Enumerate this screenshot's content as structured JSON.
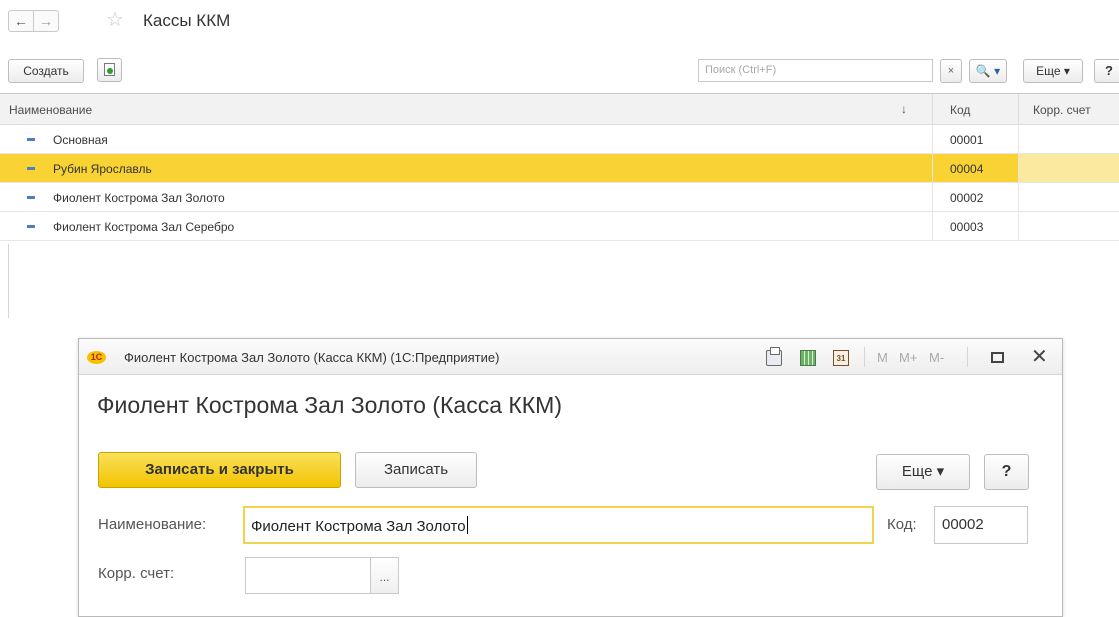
{
  "list_window": {
    "title": "Кассы ККМ",
    "toolbar": {
      "create_label": "Создать",
      "search_placeholder": "Поиск (Ctrl+F)",
      "clear_label": "×",
      "find_label": "🔍 ▾",
      "more_label": "Еще ▾",
      "help_label": "?"
    },
    "columns": {
      "name": "Наименование",
      "sort_arrow": "↓",
      "code": "Код",
      "corr_account": "Корр. счет"
    },
    "rows": [
      {
        "name": "Основная",
        "code": "00001",
        "corr_account": "",
        "selected": false
      },
      {
        "name": "Рубин Ярославль",
        "code": "00004",
        "corr_account": "",
        "selected": true
      },
      {
        "name": "Фиолент Кострома Зал Золото",
        "code": "00002",
        "corr_account": "",
        "selected": false
      },
      {
        "name": "Фиолент Кострома Зал Серебро",
        "code": "00003",
        "corr_account": "",
        "selected": false
      }
    ]
  },
  "dialog": {
    "window_title": "Фиолент Кострома Зал Золото (Касса ККМ)  (1С:Предприятие)",
    "logo_text": "1С",
    "calendar_icon_text": "31",
    "mem_buttons": [
      "M",
      "M+",
      "M-"
    ],
    "heading": "Фиолент Кострома Зал Золото (Касса ККМ)",
    "save_close_label": "Записать и закрыть",
    "save_label": "Записать",
    "more_label": "Еще ▾",
    "help_label": "?",
    "name_label": "Наименование:",
    "name_value": "Фиолент Кострома Зал Золото",
    "code_label": "Код:",
    "code_value": "00002",
    "corr_label": "Корр. счет:",
    "corr_value": "",
    "choose_label": "..."
  },
  "colors": {
    "selected_row": "#f8d333",
    "primary_button": "#f1c400",
    "active_field_border": "#f2d34f",
    "row_marker": "#4f7ec0"
  },
  "icons": [
    "back-arrow-icon",
    "forward-arrow-icon",
    "favorite-star-icon",
    "copy-icon",
    "search-icon",
    "print-icon",
    "calculator-icon",
    "calendar-icon",
    "maximize-icon",
    "close-icon"
  ]
}
